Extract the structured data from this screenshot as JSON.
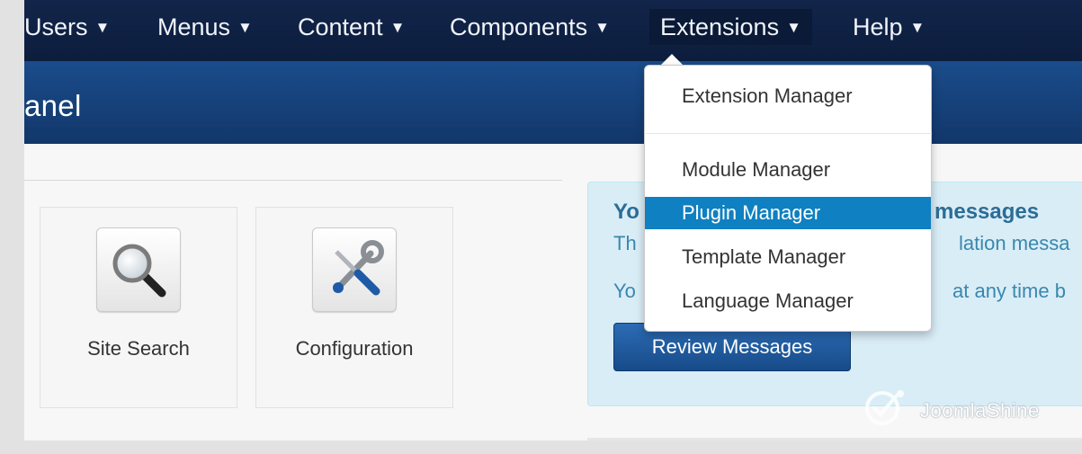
{
  "navbar": {
    "items": [
      {
        "label": "Users",
        "caret": "▼"
      },
      {
        "label": "Menus",
        "caret": "▼"
      },
      {
        "label": "Content",
        "caret": "▼"
      },
      {
        "label": "Components",
        "caret": "▼"
      },
      {
        "label": "Extensions",
        "caret": "▼"
      },
      {
        "label": "Help",
        "caret": "▼"
      }
    ]
  },
  "header": {
    "title": "anel"
  },
  "quick_icons": [
    {
      "label": "Site Search",
      "icon": "magnifier-icon"
    },
    {
      "label": "Configuration",
      "icon": "tools-icon"
    }
  ],
  "messages": {
    "title_start": "Yo",
    "title_end": "messages",
    "line1_start": "Th",
    "line1_end": "lation messa",
    "line2_start": "Yo",
    "line2_end": "at any time b",
    "button_label": "Review Messages"
  },
  "extensions_menu": {
    "items": [
      {
        "label": "Extension Manager"
      },
      {
        "label": "Module Manager"
      },
      {
        "label": "Plugin Manager",
        "highlighted": true
      },
      {
        "label": "Template Manager"
      },
      {
        "label": "Language Manager"
      }
    ]
  },
  "watermark": {
    "text": "JoomlaShine"
  },
  "colors": {
    "navbar": "#0c1d3d",
    "header": "#1a4c8b",
    "highlight": "#0f80c1",
    "message_bg": "#d9edf7",
    "button": "#174b89"
  }
}
